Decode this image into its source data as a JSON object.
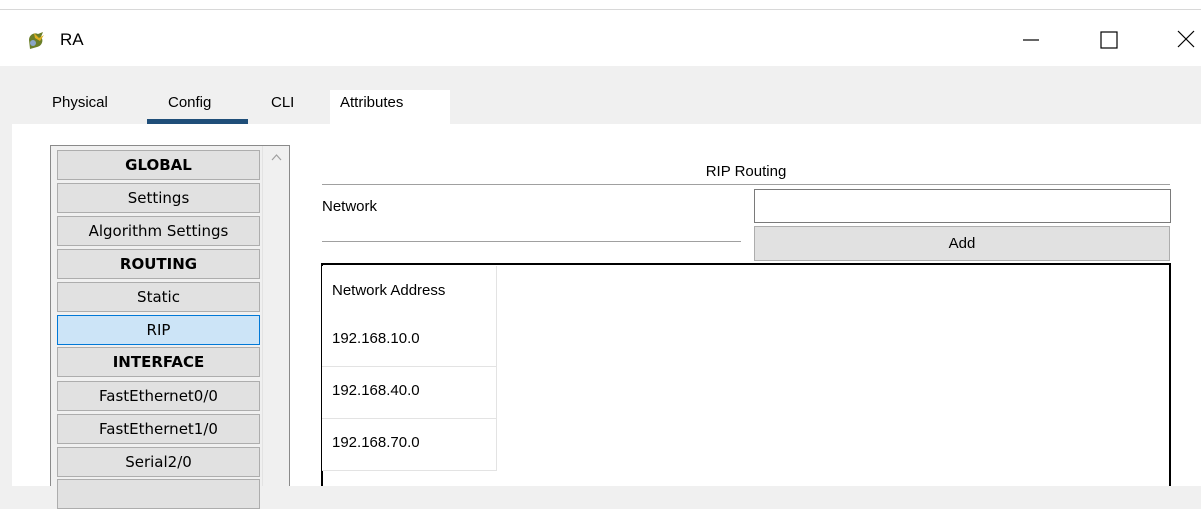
{
  "window": {
    "title": "RA",
    "controls": {
      "minimize": "—",
      "maximize": "☐",
      "close": "✕"
    }
  },
  "tabs": [
    {
      "label": "Physical"
    },
    {
      "label": "Config",
      "active": true
    },
    {
      "label": "CLI"
    },
    {
      "label": "Attributes"
    }
  ],
  "sidebar": {
    "items": [
      {
        "label": "GLOBAL",
        "type": "header"
      },
      {
        "label": "Settings"
      },
      {
        "label": "Algorithm Settings"
      },
      {
        "label": "ROUTING",
        "type": "header"
      },
      {
        "label": "Static"
      },
      {
        "label": "RIP",
        "selected": true
      },
      {
        "label": "INTERFACE",
        "type": "header"
      },
      {
        "label": "FastEthernet0/0"
      },
      {
        "label": "FastEthernet1/0"
      },
      {
        "label": "Serial2/0"
      }
    ]
  },
  "rip": {
    "heading": "RIP Routing",
    "network_label": "Network",
    "network_value": "",
    "add_label": "Add",
    "table": {
      "header": "Network Address",
      "rows": [
        "192.168.10.0",
        "192.168.40.0",
        "192.168.70.0"
      ]
    }
  },
  "colors": {
    "tab_underline": "#1f4e79",
    "selected_item_bg": "#cce4f7",
    "selected_item_border": "#0078d7"
  }
}
